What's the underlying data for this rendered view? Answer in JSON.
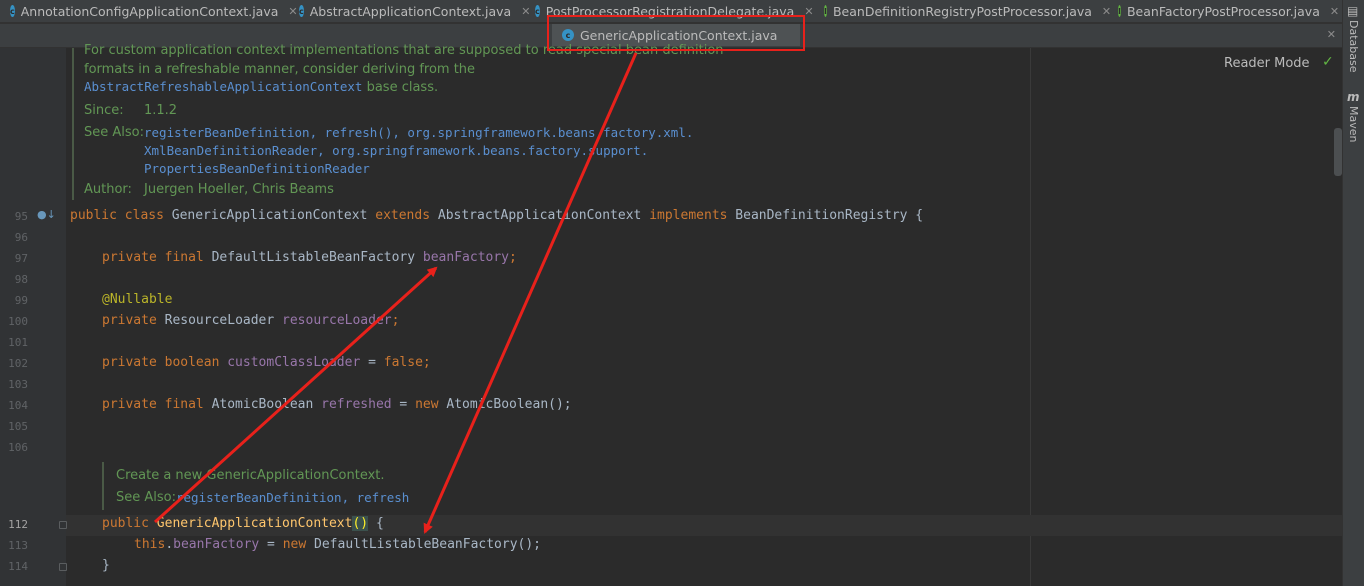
{
  "tabs_row1": [
    {
      "label": "AnnotationConfigApplicationContext.java",
      "icon": "class-icon"
    },
    {
      "label": "AbstractApplicationContext.java",
      "icon": "class-icon"
    },
    {
      "label": "PostProcessorRegistrationDelegate.java",
      "icon": "class-icon"
    },
    {
      "label": "BeanDefinitionRegistryPostProcessor.java",
      "icon": "interface-icon"
    },
    {
      "label": "BeanFactoryPostProcessor.java",
      "icon": "interface-icon"
    }
  ],
  "active_tab": {
    "label": "GenericApplicationContext.java",
    "icon": "class-icon"
  },
  "reader_mode": "Reader Mode",
  "right_toolwindows": [
    "Database",
    "Maven"
  ],
  "doc_top": {
    "line1": "For custom application context implementations that are supposed to read special bean definition",
    "line2": "formats in a refreshable manner, consider deriving from the",
    "line3_link": "AbstractRefreshableApplicationContext",
    "line3_tail": " base class.",
    "since_label": "Since:",
    "since_value": "1.1.2",
    "seealso_label": "See Also:",
    "seealso_line1": "registerBeanDefinition, refresh(), org.springframework.beans.factory.xml.",
    "seealso_line2": "XmlBeanDefinitionReader, org.springframework.beans.factory.support.",
    "seealso_line3": "PropertiesBeanDefinitionReader",
    "author_label": "Author:",
    "author_value": "Juergen Hoeller, Chris Beams"
  },
  "doc_ctor": {
    "line1": "Create a new GenericApplicationContext.",
    "seealso_label": "See Also:",
    "seealso_value": "registerBeanDefinition, refresh"
  },
  "line_numbers": {
    "l95": "95",
    "l96": "96",
    "l97": "97",
    "l98": "98",
    "l99": "99",
    "l100": "100",
    "l101": "101",
    "l102": "102",
    "l103": "103",
    "l104": "104",
    "l105": "105",
    "l106": "106",
    "l112": "112",
    "l113": "113",
    "l114": "114"
  },
  "code": {
    "l95": {
      "kw1": "public class ",
      "name": "GenericApplicationContext ",
      "kw2": "extends ",
      "sup": "AbstractApplicationContext ",
      "kw3": "implements ",
      "iface": "BeanDefinitionRegistry {"
    },
    "l97": {
      "kw": "private final ",
      "type": "DefaultListableBeanFactory ",
      "field": "beanFactory",
      "semi": ";"
    },
    "l99": {
      "ann": "@Nullable"
    },
    "l100": {
      "kw": "private ",
      "type": "ResourceLoader ",
      "field": "resourceLoader",
      "semi": ";"
    },
    "l102": {
      "kw": "private boolean ",
      "field": "customClassLoader",
      "eq": " = ",
      "val": "false",
      "semi": ";"
    },
    "l104": {
      "kw": "private final ",
      "type": "AtomicBoolean ",
      "field": "refreshed",
      "eq": " = ",
      "new": "new ",
      "ctor": "AtomicBoolean();"
    },
    "l112": {
      "kw": "public ",
      "name": "GenericApplicationContext",
      "parens": "()",
      "brace": " {"
    },
    "l113": {
      "kw": "this",
      "dot": ".",
      "field": "beanFactory",
      "eq": " = ",
      "new": "new ",
      "ctor": "DefaultListableBeanFactory();"
    },
    "l114": {
      "brace": "}"
    }
  },
  "colors": {
    "annotation_red": "#e8211b",
    "keyword": "#cc7832",
    "field": "#9876aa",
    "doc": "#629755"
  }
}
